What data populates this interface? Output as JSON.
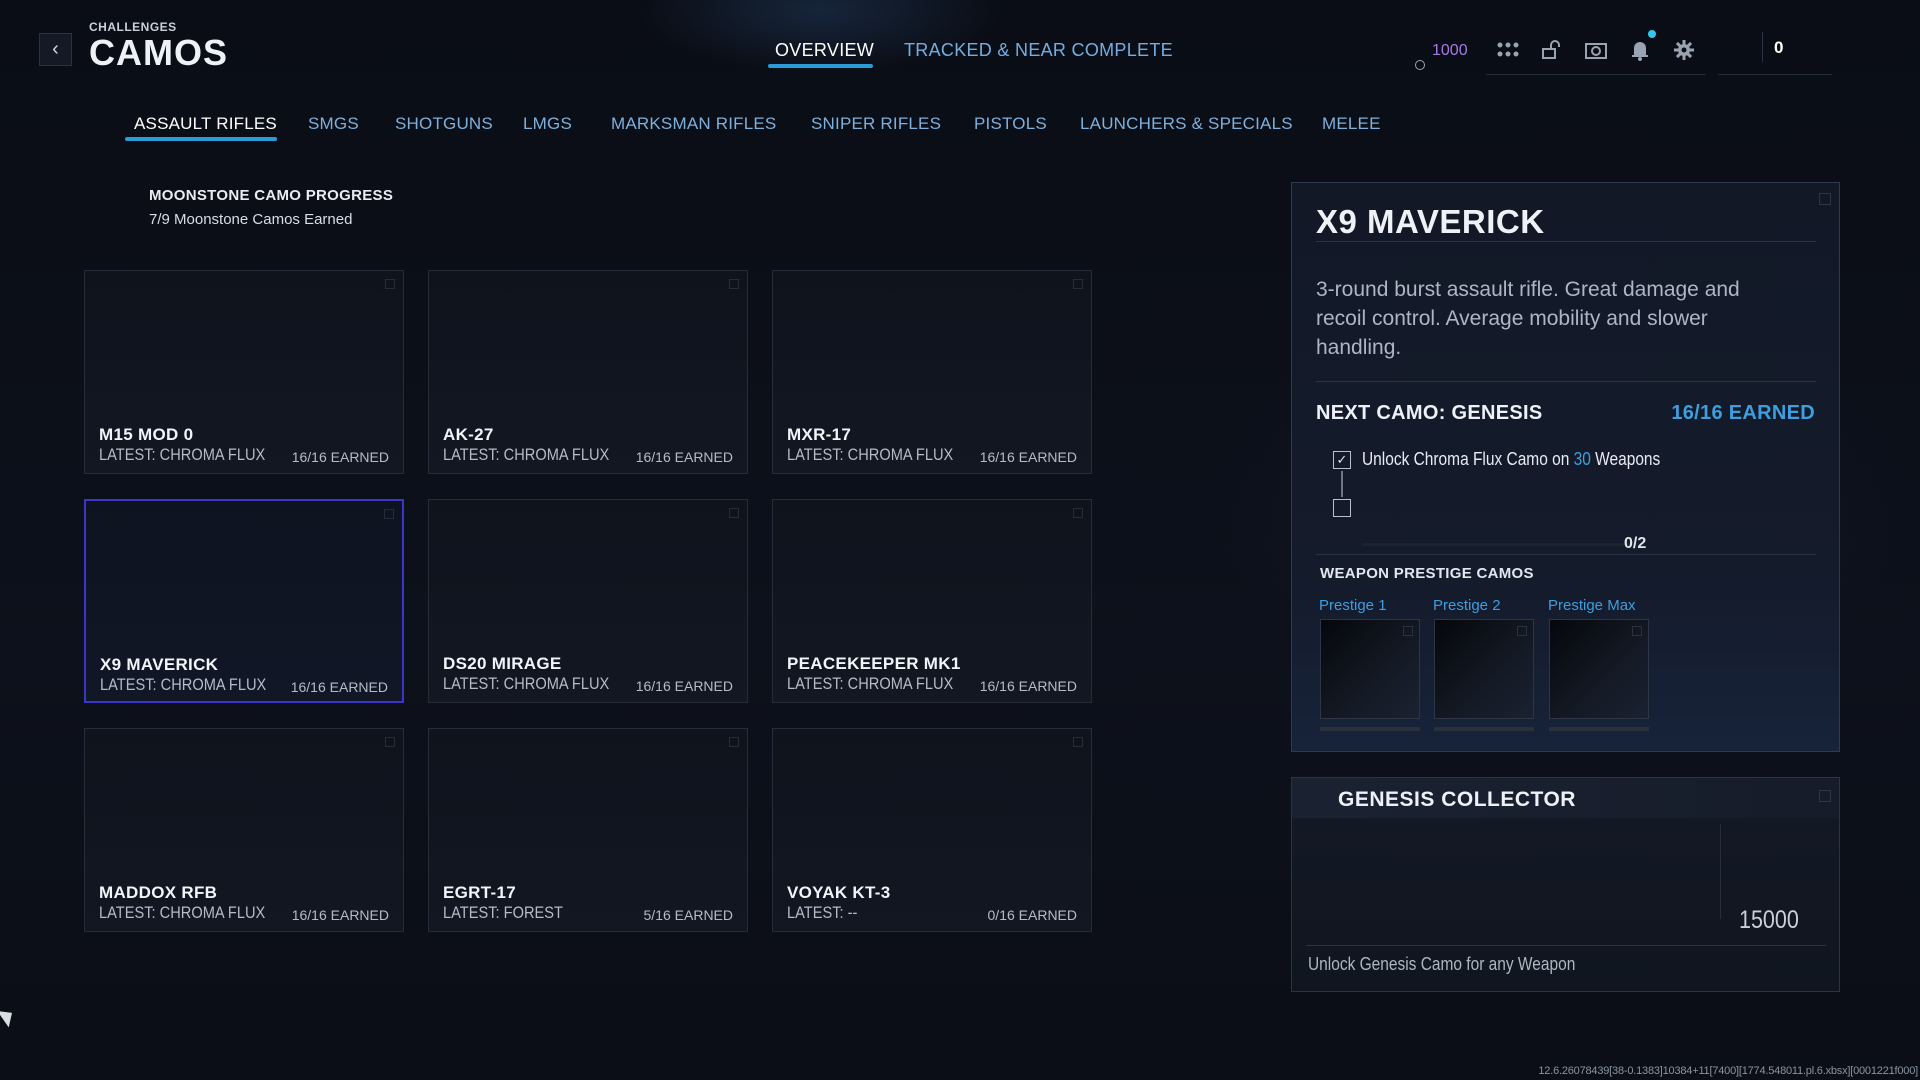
{
  "header": {
    "subtitle": "CHALLENGES",
    "title": "CAMOS",
    "back_icon": "chevron-left-icon",
    "tabs": [
      {
        "label": "OVERVIEW",
        "active": true
      },
      {
        "label": "TRACKED & NEAR COMPLETE",
        "active": false
      }
    ],
    "currency_value": "1000",
    "icons": [
      "grid-icon",
      "unlock-icon",
      "camera-icon",
      "bell-icon",
      "gear-icon"
    ],
    "player_count": "0"
  },
  "categories": [
    {
      "label": "ASSAULT RIFLES",
      "active": true
    },
    {
      "label": "SMGS"
    },
    {
      "label": "SHOTGUNS"
    },
    {
      "label": "LMGS"
    },
    {
      "label": "MARKSMAN RIFLES"
    },
    {
      "label": "SNIPER RIFLES"
    },
    {
      "label": "PISTOLS"
    },
    {
      "label": "LAUNCHERS & SPECIALS"
    },
    {
      "label": "MELEE"
    }
  ],
  "progress": {
    "title": "MOONSTONE CAMO PROGRESS",
    "subtitle": "7/9 Moonstone Camos Earned"
  },
  "weapons": [
    {
      "name": "M15 MOD 0",
      "latest": "LATEST: CHROMA FLUX",
      "earned": "16/16 EARNED"
    },
    {
      "name": "AK-27",
      "latest": "LATEST: CHROMA FLUX",
      "earned": "16/16 EARNED"
    },
    {
      "name": "MXR-17",
      "latest": "LATEST: CHROMA FLUX",
      "earned": "16/16 EARNED"
    },
    {
      "name": "X9 MAVERICK",
      "latest": "LATEST: CHROMA FLUX",
      "earned": "16/16 EARNED",
      "selected": true
    },
    {
      "name": "DS20 MIRAGE",
      "latest": "LATEST: CHROMA FLUX",
      "earned": "16/16 EARNED"
    },
    {
      "name": "PEACEKEEPER MK1",
      "latest": "LATEST: CHROMA FLUX",
      "earned": "16/16 EARNED"
    },
    {
      "name": "MADDOX RFB",
      "latest": "LATEST: CHROMA FLUX",
      "earned": "16/16 EARNED"
    },
    {
      "name": "EGRT-17",
      "latest": "LATEST: FOREST",
      "earned": "5/16 EARNED"
    },
    {
      "name": "VOYAK KT-3",
      "latest": "LATEST: --",
      "earned": "0/16 EARNED"
    }
  ],
  "detail": {
    "title": "X9 MAVERICK",
    "description": "3-round burst assault rifle. Great damage and recoil control. Average mobility and slower handling.",
    "next_camo": "NEXT CAMO: GENESIS",
    "next_earned": "16/16 EARNED",
    "task": {
      "prefix": "Unlock Chroma Flux Camo on ",
      "count": "30",
      "suffix": " Weapons",
      "checked": true
    },
    "task_progress": "0/2",
    "prestige_title": "WEAPON PRESTIGE CAMOS",
    "prestige": [
      "Prestige 1",
      "Prestige 2",
      "Prestige Max"
    ]
  },
  "collector": {
    "title": "GENESIS COLLECTOR",
    "value": "15000",
    "description": "Unlock Genesis Camo for any Weapon"
  },
  "build_id": "12.6.26078439[38-0.1383]10384+11[7400][1774.548011.pl.6.xbsx][0001221f000]",
  "colors": {
    "accent": "#2b9bd8",
    "highlight_text": "#3d9ee0",
    "currency": "#a779e6",
    "selected_border": "#3a36c9"
  }
}
